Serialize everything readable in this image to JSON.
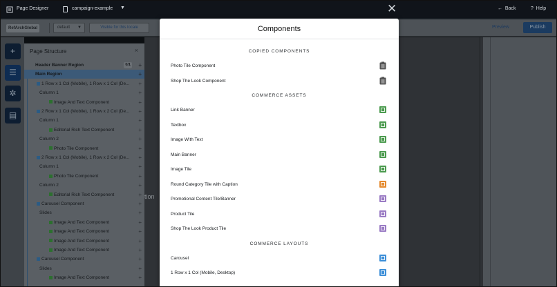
{
  "topbar": {
    "app_title": "Page Designer",
    "page_name": "campaign-example",
    "close_glyph": "✕",
    "back_label": "Back",
    "help_label": "Help",
    "icons": [
      "menu-icon",
      "file-icon",
      "chevron-down-icon",
      "close-icon",
      "back-arrow-icon",
      "help-icon"
    ]
  },
  "toolbar": {
    "site": "RefArchGlobal",
    "locale": "default",
    "visibility": "Visible for this locale",
    "preview": "Preview",
    "publish": "Publish"
  },
  "rail": {
    "buttons": [
      {
        "name": "add",
        "glyph": "+"
      },
      {
        "name": "structure",
        "glyph": "☰"
      },
      {
        "name": "settings",
        "glyph": "✲"
      },
      {
        "name": "library",
        "glyph": "▤"
      }
    ]
  },
  "structure": {
    "title": "Page Structure",
    "close_glyph": "×",
    "rows": [
      {
        "text": "Header Banner Region",
        "badge": "0/1",
        "bold": true
      },
      {
        "text": "Main Region",
        "bold": true,
        "selected": true
      },
      {
        "text": "1 Row x 1 Col (Mobile), 1 Row x 1 Col (De...",
        "kind": "layout"
      },
      {
        "text": "Column 1",
        "kind": "col"
      },
      {
        "text": "Image And Text Component",
        "kind": "comp"
      },
      {
        "text": "2 Row x 1 Col (Mobile), 1 Row x 2 Col (De...",
        "kind": "layout"
      },
      {
        "text": "Column 1",
        "kind": "col"
      },
      {
        "text": "Editorial Rich Text Component",
        "kind": "comp"
      },
      {
        "text": "Column 2",
        "kind": "col"
      },
      {
        "text": "Photo Tile Component",
        "kind": "comp"
      },
      {
        "text": "2 Row x 1 Col (Mobile), 1 Row x 2 Col (De...",
        "kind": "layout"
      },
      {
        "text": "Column 1",
        "kind": "col"
      },
      {
        "text": "Photo Tile Component",
        "kind": "comp"
      },
      {
        "text": "Column 2",
        "kind": "col"
      },
      {
        "text": "Editorial Rich Text Component",
        "kind": "comp"
      },
      {
        "text": "Carousel Component",
        "kind": "layout"
      },
      {
        "text": "Slides",
        "kind": "col"
      },
      {
        "text": "Image And Text Component",
        "kind": "comp"
      },
      {
        "text": "Image And Text Component",
        "kind": "comp"
      },
      {
        "text": "Image And Text Component",
        "kind": "comp"
      },
      {
        "text": "Image And Text Component",
        "kind": "comp"
      },
      {
        "text": "Carousel Component",
        "kind": "layout"
      },
      {
        "text": "Slides",
        "kind": "col"
      },
      {
        "text": "Image And Text Component",
        "kind": "comp"
      }
    ]
  },
  "canvas": {
    "ghost_text": "tion"
  },
  "modal": {
    "title": "Components",
    "sections": [
      {
        "heading": "COPIED COMPONENTS",
        "items": [
          {
            "label": "Photo Tile Component",
            "icon": "clipboard-icon",
            "color": "#444444"
          },
          {
            "label": "Shop The Look Component",
            "icon": "clipboard-icon",
            "color": "#444444"
          }
        ]
      },
      {
        "heading": "COMMERCE ASSETS",
        "items": [
          {
            "label": "Link Banner",
            "icon": "asset-icon",
            "color": "#4c9b4f"
          },
          {
            "label": "Textbox",
            "icon": "asset-icon",
            "color": "#4c9b4f"
          },
          {
            "label": "Image With Text",
            "icon": "asset-icon",
            "color": "#4c9b4f"
          },
          {
            "label": "Main Banner",
            "icon": "asset-icon",
            "color": "#4c9b4f"
          },
          {
            "label": "Image Tile",
            "icon": "asset-icon",
            "color": "#4c9b4f"
          },
          {
            "label": "Round Category Tile with Caption",
            "icon": "category-icon",
            "color": "#e58a2e"
          },
          {
            "label": "Promotional Content Tile/Banner",
            "icon": "product-icon",
            "color": "#9a7bc4"
          },
          {
            "label": "Product Tile",
            "icon": "product-icon",
            "color": "#9a7bc4"
          },
          {
            "label": "Shop The Look Product Tile",
            "icon": "product-icon",
            "color": "#9a7bc4"
          }
        ]
      },
      {
        "heading": "COMMERCE LAYOUTS",
        "items": [
          {
            "label": "Carousel",
            "icon": "layout-icon",
            "color": "#3d8fd8"
          },
          {
            "label": "1 Row x 1 Col (Mobile, Desktop)",
            "icon": "layout-icon",
            "color": "#3d8fd8"
          }
        ]
      }
    ]
  }
}
